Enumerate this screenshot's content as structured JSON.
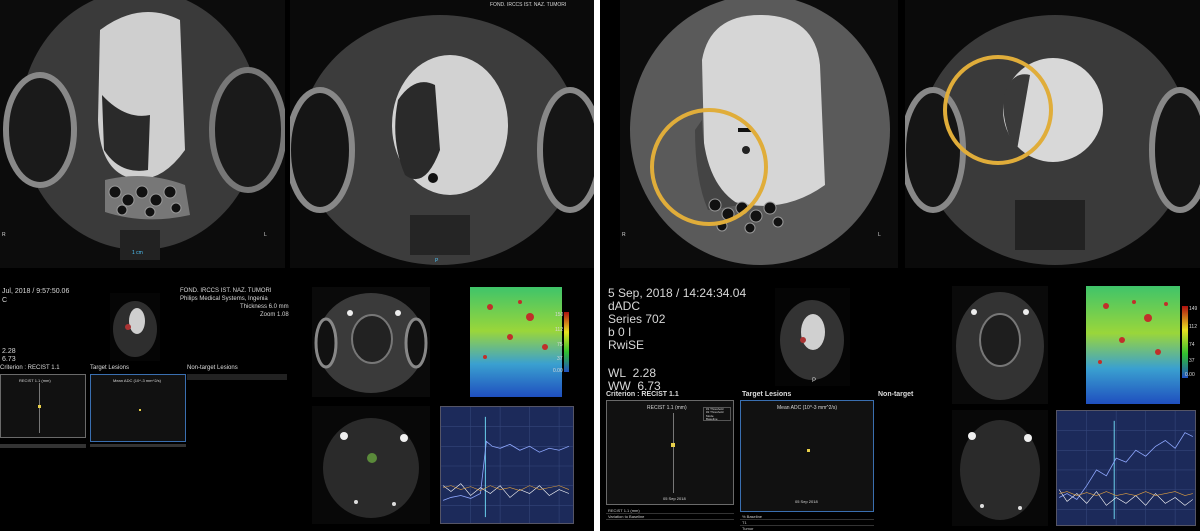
{
  "left_panel": {
    "top_left_image": {
      "orientation_right": "L",
      "orientation_left": "R",
      "scale_text": "1 cm"
    },
    "top_right_image": {
      "hospital": "FOND. IRCCS IST. NAZ. TUMORI",
      "orientation_bottom": "P"
    },
    "bottom": {
      "date_time": "Jul, 2018 / 9:57:50.06",
      "series_prefix": "C",
      "hospital": "FOND. IRCCS IST. NAZ. TUMORI",
      "vendor": "Philips Medical Systems, Ingenia",
      "thickness": "Thickness 6.0 mm",
      "zoom": "Zoom 1.08",
      "wl": "2.28",
      "ww": "6.73",
      "criterion": "Criterion : RECIST 1.1",
      "target_lesions": "Target Lesions",
      "nontarget_lesions": "Non-target Lesions",
      "chart1_title": "RECIST 1.1 (mm)",
      "chart2_title": "Mean ADC (10^-3 mm^2/s)",
      "colorbar_ticks": [
        "150",
        "112",
        "75",
        "37",
        "0.00"
      ]
    }
  },
  "right_panel": {
    "top_left_image": {
      "orientation_right": "L",
      "orientation_left": "R"
    },
    "bottom": {
      "date_time": "5 Sep, 2018 / 14:24:34.04",
      "map": "dADC",
      "series": "Series 702",
      "b_value": "b 0 I",
      "sequence": "RwiSE",
      "wl_label": "WL",
      "wl": "2.28",
      "ww_label": "WW",
      "ww": "6.73",
      "orientation_bottom": "P",
      "criterion": "Criterion : RECIST 1.1",
      "target_lesions": "Target Lesions",
      "nontarget_lesions": "Non-target",
      "chart1_title": "RECIST 1.1 (mm)",
      "chart1_xlabel": "05 Sep 2018",
      "chart2_title": "Mean ADC (10^-3 mm^2/s)",
      "chart2_xlabel": "05 Sep 2018",
      "colorbar_ticks": [
        "149",
        "112",
        "74",
        "37",
        "0.00"
      ],
      "row_labels": [
        "RECIST 1.1 (mm)",
        "Variation to Baseline",
        "% Baseline",
        "T1",
        "Tumor",
        "Total"
      ],
      "legend": [
        "#1 Threshold",
        "#2 Threshold",
        "Mode",
        "Baseline"
      ]
    }
  },
  "colors": {
    "background": "#000000",
    "divider": "#ffffff",
    "highlight_ring": "#e0ad3a",
    "selected_box": "#3a6fb0",
    "chart_bg": "#1c2a5a"
  }
}
